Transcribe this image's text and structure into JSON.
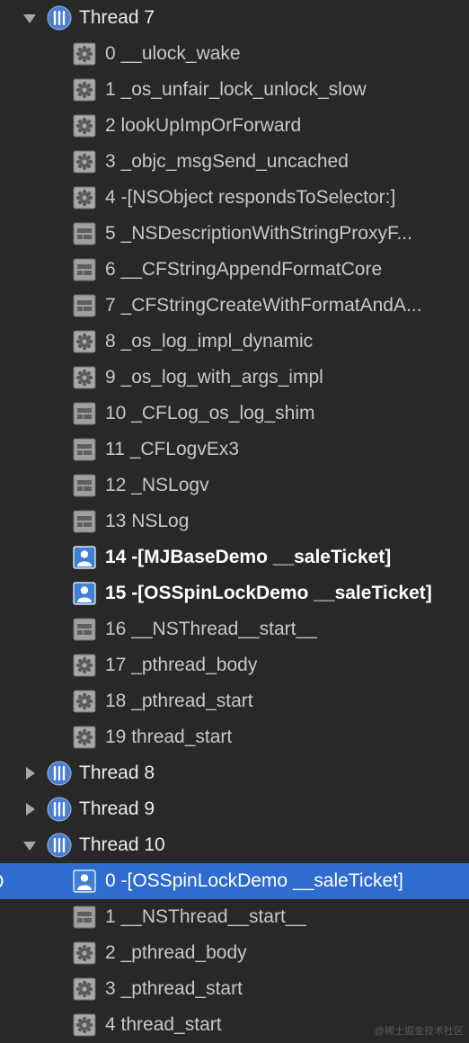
{
  "threads": [
    {
      "label": "Thread 7",
      "expanded": true,
      "frames": [
        {
          "label": "0 __ulock_wake",
          "icon": "gear-icon"
        },
        {
          "label": "1 _os_unfair_lock_unlock_slow",
          "icon": "gear-icon"
        },
        {
          "label": "2 lookUpImpOrForward",
          "icon": "gear-icon"
        },
        {
          "label": "3 _objc_msgSend_uncached",
          "icon": "gear-icon"
        },
        {
          "label": "4 -[NSObject respondsToSelector:]",
          "icon": "gear-icon"
        },
        {
          "label": "5 _NSDescriptionWithStringProxyF...",
          "icon": "framework-icon"
        },
        {
          "label": "6 __CFStringAppendFormatCore",
          "icon": "framework-icon"
        },
        {
          "label": "7 _CFStringCreateWithFormatAndA...",
          "icon": "framework-icon"
        },
        {
          "label": "8 _os_log_impl_dynamic",
          "icon": "gear-icon"
        },
        {
          "label": "9 _os_log_with_args_impl",
          "icon": "gear-icon"
        },
        {
          "label": "10 _CFLog_os_log_shim",
          "icon": "framework-icon"
        },
        {
          "label": "11 _CFLogvEx3",
          "icon": "framework-icon"
        },
        {
          "label": "12 _NSLogv",
          "icon": "framework-icon"
        },
        {
          "label": "13 NSLog",
          "icon": "framework-icon"
        },
        {
          "label": "14 -[MJBaseDemo __saleTicket]",
          "icon": "user-code-icon"
        },
        {
          "label": "15 -[OSSpinLockDemo __saleTicket]",
          "icon": "user-code-icon"
        },
        {
          "label": "16 __NSThread__start__",
          "icon": "framework-icon"
        },
        {
          "label": "17 _pthread_body",
          "icon": "gear-icon"
        },
        {
          "label": "18 _pthread_start",
          "icon": "gear-icon"
        },
        {
          "label": "19 thread_start",
          "icon": "gear-icon"
        }
      ]
    },
    {
      "label": "Thread 8",
      "expanded": false,
      "frames": []
    },
    {
      "label": "Thread 9",
      "expanded": false,
      "frames": []
    },
    {
      "label": "Thread 10",
      "expanded": true,
      "frames": [
        {
          "label": "0 -[OSSpinLockDemo __saleTicket]",
          "icon": "user-code-icon",
          "selected": true
        },
        {
          "label": "1 __NSThread__start__",
          "icon": "framework-icon"
        },
        {
          "label": "2 _pthread_body",
          "icon": "gear-icon"
        },
        {
          "label": "3 _pthread_start",
          "icon": "gear-icon"
        },
        {
          "label": "4 thread_start",
          "icon": "gear-icon"
        }
      ]
    }
  ],
  "watermark": "@稀土掘金技术社区",
  "colors": {
    "background": "#282828",
    "selection": "#2f6ccf",
    "thread_icon": "#4a7ed0",
    "user_icon": "#3f7fd6",
    "system_icon": "#8a8a8a"
  }
}
